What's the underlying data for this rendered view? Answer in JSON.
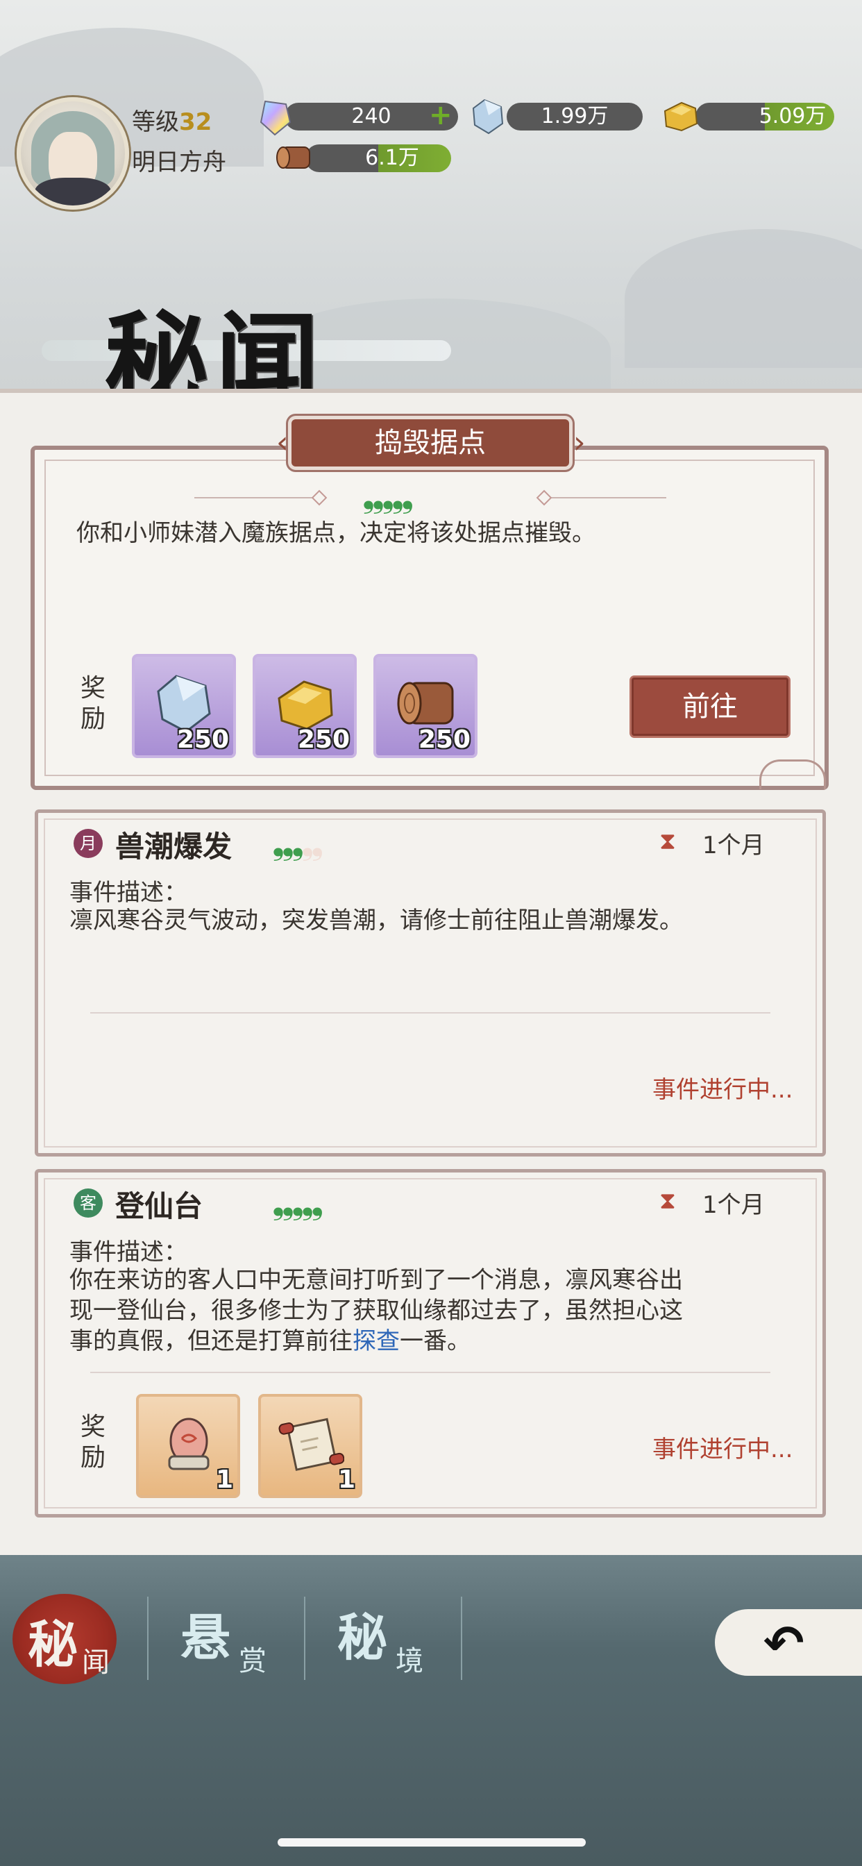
{
  "header": {
    "level_label": "等级",
    "level_value": "32",
    "player_name": "明日方舟",
    "resources": [
      {
        "icon": "rainbow-crystal-icon",
        "value": "240",
        "has_plus": true
      },
      {
        "icon": "spirit-stone-icon",
        "value": "1.99万"
      },
      {
        "icon": "gold-ore-icon",
        "value": "5.09万"
      },
      {
        "icon": "wood-log-icon",
        "value": "6.1万"
      }
    ]
  },
  "page": {
    "title": "秘闻"
  },
  "featured_event": {
    "tab_label": "捣毁据点",
    "difficulty": {
      "filled": 5,
      "total": 5
    },
    "description": "你和小师妹潜入魔族据点，决定将该处据点摧毁。",
    "reward_label_line1": "奖",
    "reward_label_line2": "励",
    "rewards": [
      {
        "icon": "spirit-stone-icon",
        "qty": "250"
      },
      {
        "icon": "gold-ore-icon",
        "qty": "250"
      },
      {
        "icon": "wood-log-icon",
        "qty": "250"
      }
    ],
    "go_button": "前往"
  },
  "events": [
    {
      "badge": "月",
      "title": "兽潮爆发",
      "difficulty": {
        "filled": 3,
        "total": 5
      },
      "duration": "1个月",
      "desc_label": "事件描述：",
      "description": "凛风寒谷灵气波动，突发兽潮，请修士前往阻止兽潮爆发。",
      "status": "事件进行中..."
    },
    {
      "badge": "客",
      "title": "登仙台",
      "difficulty": {
        "filled": 5,
        "total": 5
      },
      "duration": "1个月",
      "desc_label": "事件描述：",
      "description_line1": "你在来访的客人口中无意间打听到了一个消息，凛风寒谷出",
      "description_line2": "现一登仙台，很多修士为了获取仙缘都过去了，虽然担心这",
      "description_line3_before": "事的真假，但还是打算前往",
      "description_line3_link": "探查",
      "description_line3_after": "一番。",
      "reward_label_line1": "奖",
      "reward_label_line2": "励",
      "rewards": [
        {
          "icon": "spirit-egg-icon",
          "qty": "1"
        },
        {
          "icon": "scroll-icon",
          "qty": "1"
        }
      ],
      "status": "事件进行中..."
    }
  ],
  "nav": {
    "tabs": [
      {
        "big": "秘",
        "small": "闻",
        "active": true
      },
      {
        "big": "悬",
        "small": "赏",
        "active": false
      },
      {
        "big": "秘",
        "small": "境",
        "active": false
      }
    ],
    "back_icon": "back-arrow-icon"
  },
  "colors": {
    "accent_red": "#9c4b3e",
    "difficulty_green": "#3f9e4e",
    "status_red": "#b04130",
    "link_blue": "#2e67b8"
  }
}
